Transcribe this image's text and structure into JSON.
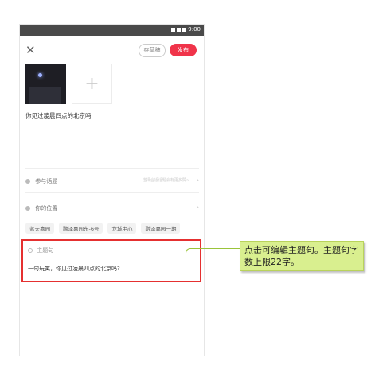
{
  "status_bar": {
    "time": "9:00"
  },
  "header": {
    "close_icon": "close-icon",
    "draft_label": "存草稿",
    "publish_label": "发布"
  },
  "media": {
    "add_icon": "+"
  },
  "caption": "你见过凌晨四点的北京吗",
  "topic_row": {
    "label": "参与话题",
    "hint": "选择合适话题会有更多赞~"
  },
  "location_row": {
    "label": "你的位置"
  },
  "location_tags": [
    "蓝天嘉园",
    "融泽嘉园东-6号",
    "龙城中心",
    "融泽嘉园一期"
  ],
  "theme": {
    "label": "主题句",
    "text": "一句玩笑，你见过凌晨四点的北京吗?"
  },
  "annotation": "点击可编辑主题句。主题句字数上限22字。",
  "colors": {
    "accent": "#f0344a",
    "highlight": "#e53030",
    "callout": "#d9ef8f"
  }
}
